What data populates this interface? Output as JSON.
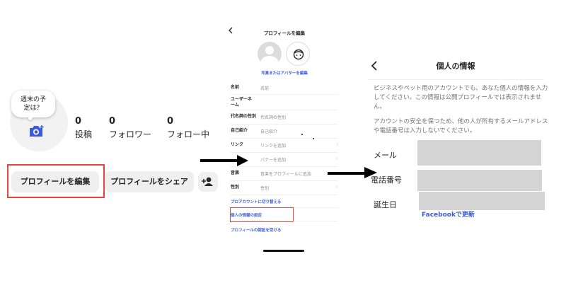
{
  "profile": {
    "note_bubble": "週末の予定は？",
    "stats": [
      {
        "value": "0",
        "label": "投稿"
      },
      {
        "value": "0",
        "label": "フォロワー"
      },
      {
        "value": "0",
        "label": "フォロー中"
      }
    ],
    "edit_button": "プロフィールを編集",
    "share_button": "プロフィールをシェア",
    "highlight_color": "#e8453c"
  },
  "edit_profile": {
    "title": "プロフィールを編集",
    "avatar_link": "写真またはアバターを編集",
    "fields": [
      {
        "label": "名前",
        "value": "名前",
        "chevron": false
      },
      {
        "label": "ユーザーネーム",
        "value": "",
        "chevron": false
      },
      {
        "label": "代名詞の性別",
        "value": "代名詞の性別",
        "chevron": false
      },
      {
        "label": "自己紹介",
        "value": "自己紹介",
        "chevron": false
      },
      {
        "label": "リンク",
        "value": "リンクを追加",
        "chevron": true
      },
      {
        "label": "",
        "value": "バナーを追加",
        "chevron": true
      },
      {
        "label": "音楽",
        "value": "音楽をプロフィールに追加",
        "chevron": true
      },
      {
        "label": "性別",
        "value": "性別",
        "chevron": true
      }
    ],
    "links": [
      "プロアカウントに切り替える",
      "個人の情報の設定",
      "プロフィールの認証を受ける"
    ],
    "link_color": "#3b5bdb"
  },
  "personal_info": {
    "title": "個人の情報",
    "description": "ビジネスやペット用のアカウントでも、あなた個人の情報を入力してください。この情報は公開プロフィールでは表示されません。",
    "safety_note": "アカウントの安全を保つため、他の人が所有するメールアドレスや電話番号は入力しないでください。",
    "fields": [
      {
        "label": "メール"
      },
      {
        "label": "電話番号"
      },
      {
        "label": "誕生日"
      }
    ],
    "facebook_link": "Facebookで更新"
  }
}
